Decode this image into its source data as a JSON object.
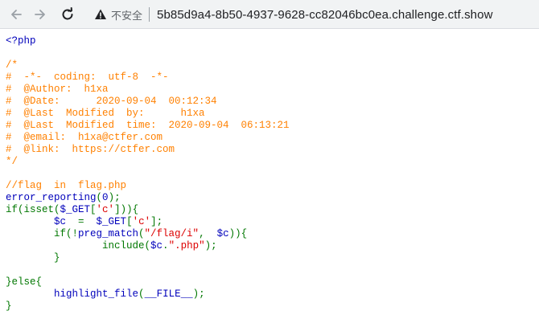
{
  "browser": {
    "security_label": "不安全",
    "url": "5b85d9a4-8b50-4937-9628-cc82046bc0ea.challenge.ctf.show"
  },
  "colors": {
    "default": "#0000BB",
    "comment": "#FF8000",
    "keyword": "#007700",
    "string": "#DD0000"
  },
  "source": {
    "lines": [
      [
        {
          "t": "<?php",
          "c": "default"
        }
      ],
      [],
      [
        {
          "t": "/*",
          "c": "comment"
        }
      ],
      [
        {
          "t": "#  -*-  coding:  utf-8  -*-",
          "c": "comment"
        }
      ],
      [
        {
          "t": "#  @Author:  h1xa",
          "c": "comment"
        }
      ],
      [
        {
          "t": "#  @Date:      2020-09-04  00:12:34",
          "c": "comment"
        }
      ],
      [
        {
          "t": "#  @Last  Modified  by:      h1xa",
          "c": "comment"
        }
      ],
      [
        {
          "t": "#  @Last  Modified  time:  2020-09-04  06:13:21",
          "c": "comment"
        }
      ],
      [
        {
          "t": "#  @email:  h1xa@ctfer.com",
          "c": "comment"
        }
      ],
      [
        {
          "t": "#  @link:  https://ctfer.com",
          "c": "comment"
        }
      ],
      [
        {
          "t": "*/",
          "c": "comment"
        }
      ],
      [],
      [
        {
          "t": "//flag  in  flag.php",
          "c": "comment"
        }
      ],
      [
        {
          "t": "error_reporting",
          "c": "default"
        },
        {
          "t": "(",
          "c": "keyword"
        },
        {
          "t": "0",
          "c": "default"
        },
        {
          "t": ");",
          "c": "keyword"
        }
      ],
      [
        {
          "t": "if(isset(",
          "c": "keyword"
        },
        {
          "t": "$_GET",
          "c": "default"
        },
        {
          "t": "[",
          "c": "keyword"
        },
        {
          "t": "'c'",
          "c": "string"
        },
        {
          "t": "])){",
          "c": "keyword"
        }
      ],
      [
        {
          "t": "        ",
          "c": "keyword"
        },
        {
          "t": "$c  ",
          "c": "default"
        },
        {
          "t": "=  ",
          "c": "keyword"
        },
        {
          "t": "$_GET",
          "c": "default"
        },
        {
          "t": "[",
          "c": "keyword"
        },
        {
          "t": "'c'",
          "c": "string"
        },
        {
          "t": "];",
          "c": "keyword"
        }
      ],
      [
        {
          "t": "        if(!",
          "c": "keyword"
        },
        {
          "t": "preg_match",
          "c": "default"
        },
        {
          "t": "(",
          "c": "keyword"
        },
        {
          "t": "\"/flag/i\"",
          "c": "string"
        },
        {
          "t": ",  ",
          "c": "keyword"
        },
        {
          "t": "$c",
          "c": "default"
        },
        {
          "t": ")){",
          "c": "keyword"
        }
      ],
      [
        {
          "t": "                include(",
          "c": "keyword"
        },
        {
          "t": "$c",
          "c": "default"
        },
        {
          "t": ".",
          "c": "keyword"
        },
        {
          "t": "\".php\"",
          "c": "string"
        },
        {
          "t": ");",
          "c": "keyword"
        }
      ],
      [
        {
          "t": "        }",
          "c": "keyword"
        }
      ],
      [],
      [
        {
          "t": "}else{",
          "c": "keyword"
        }
      ],
      [
        {
          "t": "        ",
          "c": "keyword"
        },
        {
          "t": "highlight_file",
          "c": "default"
        },
        {
          "t": "(",
          "c": "keyword"
        },
        {
          "t": "__FILE__",
          "c": "default"
        },
        {
          "t": ");",
          "c": "keyword"
        }
      ],
      [
        {
          "t": "}",
          "c": "keyword"
        }
      ]
    ]
  }
}
